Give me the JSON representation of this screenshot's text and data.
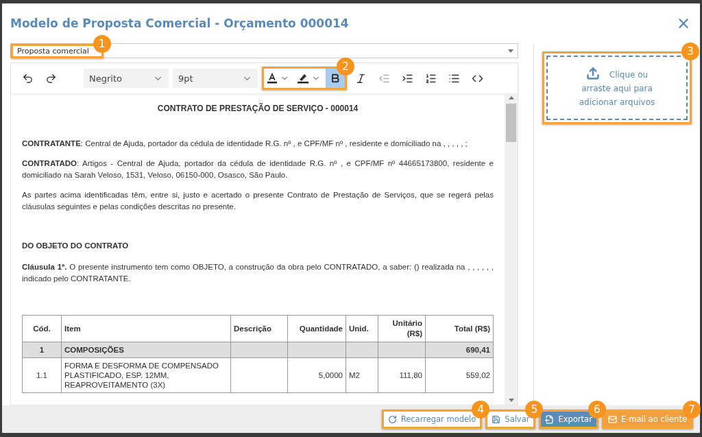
{
  "window": {
    "title": "Modelo de Proposta Comercial - Orçamento 000014",
    "close": "×"
  },
  "template_select": {
    "value": "Proposta comercial",
    "callout": "1"
  },
  "toolbar": {
    "callout": "2",
    "tools": [
      {
        "kind": "undo",
        "disabled": false
      },
      {
        "kind": "redo",
        "disabled": false
      },
      {
        "kind": "select",
        "value": "Negrito"
      },
      {
        "kind": "select",
        "value": "9pt"
      },
      {
        "kind": "font-color",
        "group": true
      },
      {
        "kind": "highlight",
        "group": true
      },
      {
        "kind": "bold",
        "selected": true,
        "group": true
      },
      {
        "kind": "italic",
        "selected": false
      },
      {
        "kind": "outdent",
        "disabled": true
      },
      {
        "kind": "indent",
        "disabled": false
      },
      {
        "kind": "ordered-list",
        "disabled": false
      },
      {
        "kind": "bullet-list",
        "disabled": false
      },
      {
        "kind": "code",
        "disabled": false
      }
    ]
  },
  "document": {
    "title": "CONTRATO DE PRESTAÇÃO DE SERVIÇO - 000014",
    "blocks": [
      {
        "kind": "paragraph",
        "text": "**CONTRATANTE**: Central de Ajuda, portador da cédula de identidade R.G. nº , e CPF/MF nº , residente e domiciliado na , , , , , ;"
      },
      {
        "kind": "paragraph",
        "text": "**CONTRATADO**: Artigos - Central de Ajuda, portador da cédula de identidade R.G. nº , e CPF/MF nº 44665173800, residente e domiciliado na Sarah Veloso, 1531, Veloso, 06150-000, Osasco, São Paulo."
      },
      {
        "kind": "paragraph",
        "text": "As partes acima identificadas têm, entre si, justo e acertado o presente Contrato de Prestação de Serviços, que se regerá pelas cláusulas seguintes e pelas condições descritas no presente."
      },
      {
        "kind": "heading",
        "text": "DO OBJETO DO CONTRATO"
      },
      {
        "kind": "paragraph",
        "text": "**Cláusula 1ª.** O presente instrumento tem como OBJETO, a construção da obra pelo CONTRATADO, a saber: () realizada na , , , , , , indicado pelo CONTRATANTE."
      }
    ],
    "table": {
      "columns": [
        "Cód.",
        "Item",
        "Descrição",
        "Quantidade",
        "Unid.",
        "Unitário (R$)",
        "Total (R$)"
      ],
      "rows": [
        {
          "kind": "group",
          "cells": [
            "1",
            "COMPOSIÇÕES",
            "",
            "",
            "",
            "",
            "690,41"
          ]
        },
        {
          "kind": "item",
          "cells": [
            "1.1",
            "FORMA E DESFORMA DE COMPENSADO PLASTIFICADO, ESP. 12MM, REAPROVEITAMENTO (3X)",
            "",
            "5,0000",
            "M2",
            "111,80",
            "559,02"
          ]
        }
      ]
    }
  },
  "upload": {
    "text": "Clique ou arraste aqui para adicionar arquivos",
    "callout": "3"
  },
  "buttons": [
    {
      "kind": "reload",
      "label": "Recarregar modelo",
      "callout": "4"
    },
    {
      "kind": "save",
      "label": "Salvar",
      "callout": "5"
    },
    {
      "kind": "export",
      "label": "Exportar",
      "callout": "6"
    },
    {
      "kind": "email",
      "label": "E-mail ao cliente",
      "callout": "7"
    }
  ]
}
